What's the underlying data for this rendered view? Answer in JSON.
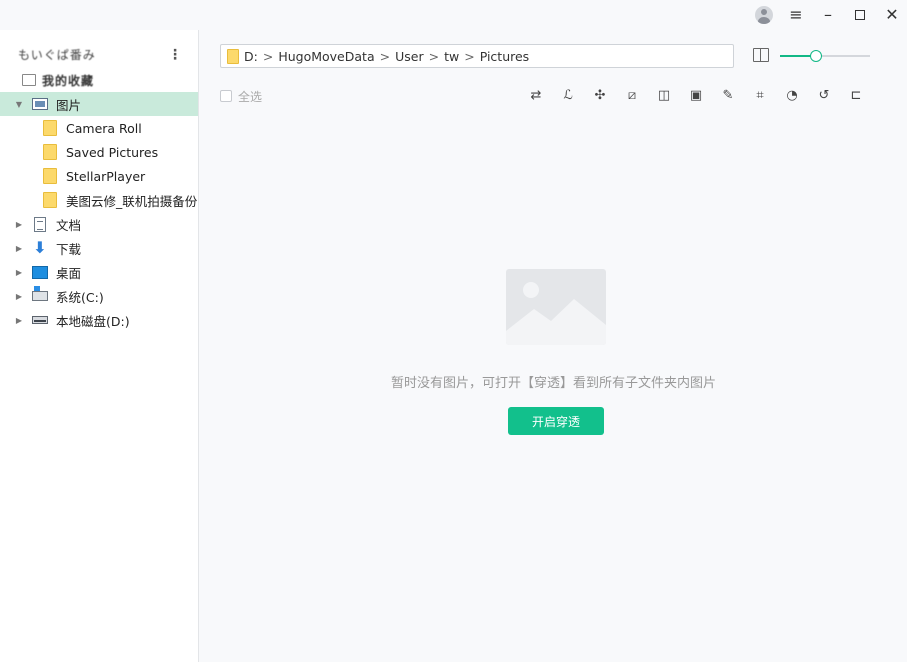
{
  "window": {
    "buttons": [
      "avatar",
      "menu",
      "minimize",
      "maximize",
      "close"
    ]
  },
  "sidebar": {
    "header_text": "もいぐぱ番み",
    "sub_text": "我的收藏",
    "tree": [
      {
        "label": "图片",
        "icon": "pictures-icon",
        "expanded": true,
        "selected": true,
        "level": 0
      },
      {
        "label": "Camera Roll",
        "icon": "folder-icon",
        "level": 1
      },
      {
        "label": "Saved Pictures",
        "icon": "folder-icon",
        "level": 1
      },
      {
        "label": "StellarPlayer",
        "icon": "folder-icon",
        "level": 1
      },
      {
        "label": "美图云修_联机拍摄备份",
        "icon": "folder-icon",
        "level": 1
      },
      {
        "label": "文档",
        "icon": "document-icon",
        "level": 0
      },
      {
        "label": "下载",
        "icon": "download-icon",
        "level": 0
      },
      {
        "label": "桌面",
        "icon": "desktop-icon",
        "level": 0
      },
      {
        "label": "系统(C:)",
        "icon": "system-drive-icon",
        "level": 0
      },
      {
        "label": "本地磁盘(D:)",
        "icon": "drive-icon",
        "level": 0
      }
    ]
  },
  "path": {
    "segments": [
      "D:",
      "HugoMoveData",
      "User",
      "tw",
      "Pictures"
    ],
    "separator": ">"
  },
  "zoom": {
    "level": 0.4
  },
  "select_all_label": "全选",
  "toolbar": [
    "convert-icon",
    "pdf-icon",
    "compress-icon",
    "resize-icon",
    "collage-icon",
    "watermark-icon",
    "edit-icon",
    "crop-icon",
    "remove-bg-icon",
    "rotate-icon",
    "rename-icon"
  ],
  "empty_state": {
    "message": "暂时没有图片，可打开【穿透】看到所有子文件夹内图片",
    "button_label": "开启穿透"
  },
  "colors": {
    "accent": "#12c08c",
    "selected_row": "#c9eadb"
  }
}
